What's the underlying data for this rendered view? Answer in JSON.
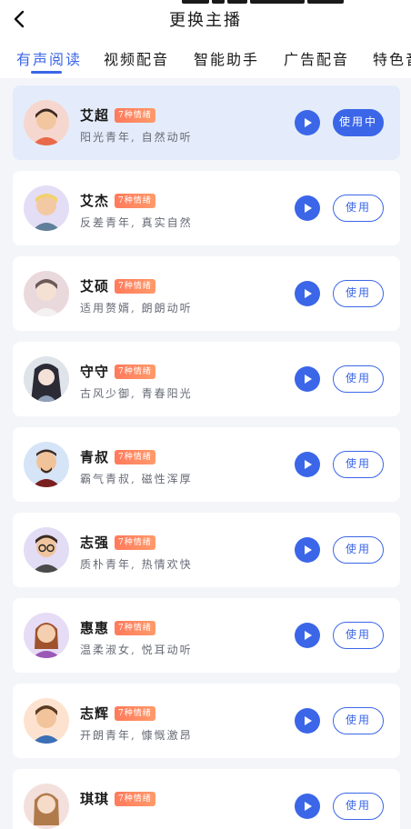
{
  "header": {
    "title": "更换主播",
    "back_icon": "chevron-left-icon"
  },
  "tabs": [
    {
      "label": "有声阅读",
      "active": true
    },
    {
      "label": "视频配音",
      "active": false
    },
    {
      "label": "智能助手",
      "active": false
    },
    {
      "label": "广告配音",
      "active": false
    },
    {
      "label": "特色音",
      "active": false
    }
  ],
  "colors": {
    "accent": "#3b66e8",
    "badge": "#ff8a62",
    "selected_bg": "#e4ecfb"
  },
  "anchors": [
    {
      "name": "艾超",
      "badge": "7种情绪",
      "desc": "阳光青年, 自然动听",
      "button": "使用中",
      "selected": true
    },
    {
      "name": "艾杰",
      "badge": "7种情绪",
      "desc": "反差青年, 真实自然",
      "button": "使用",
      "selected": false
    },
    {
      "name": "艾硕",
      "badge": "7种情绪",
      "desc": "适用赘婿, 朗朗动听",
      "button": "使用",
      "selected": false
    },
    {
      "name": "守守",
      "badge": "7种情绪",
      "desc": "古风少御, 青春阳光",
      "button": "使用",
      "selected": false
    },
    {
      "name": "青叔",
      "badge": "7种情绪",
      "desc": "霸气青叔, 磁性浑厚",
      "button": "使用",
      "selected": false
    },
    {
      "name": "志强",
      "badge": "7种情绪",
      "desc": "质朴青年, 热情欢快",
      "button": "使用",
      "selected": false
    },
    {
      "name": "惠惠",
      "badge": "7种情绪",
      "desc": "温柔淑女, 悦耳动听",
      "button": "使用",
      "selected": false
    },
    {
      "name": "志辉",
      "badge": "7种情绪",
      "desc": "开朗青年, 慷慨激昂",
      "button": "使用",
      "selected": false
    },
    {
      "name": "琪琪",
      "badge": "7种情绪",
      "desc": "",
      "button": "使用",
      "selected": false
    }
  ]
}
